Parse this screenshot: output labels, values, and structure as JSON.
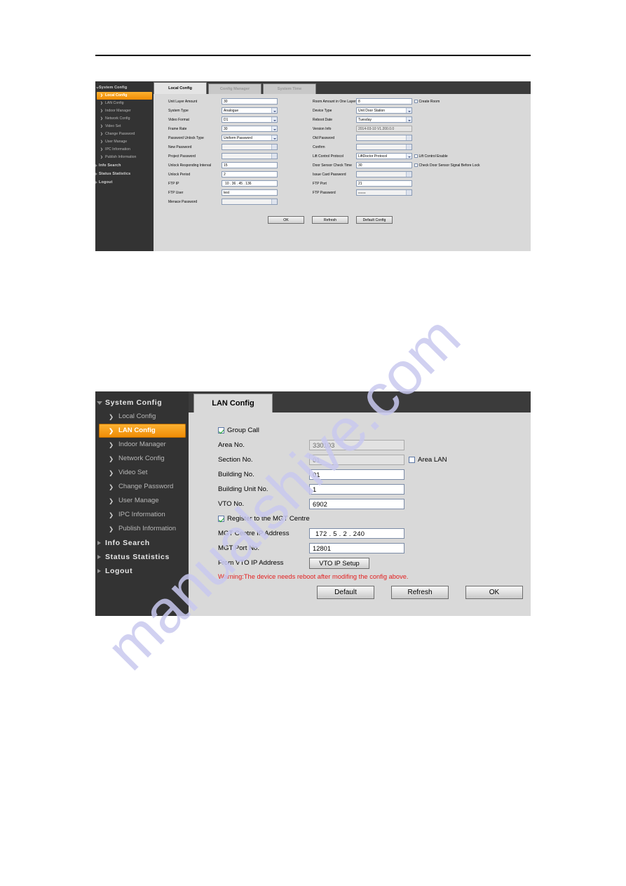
{
  "watermark": {
    "text": "manualshive.com"
  },
  "panel_local_config": {
    "tabs": [
      {
        "label": "Local Config",
        "active": true
      },
      {
        "label": "Config Manager",
        "active": false
      },
      {
        "label": "System Time",
        "active": false
      }
    ],
    "sidebar": {
      "groups": [
        {
          "label": "System Config",
          "expanded": true
        },
        {
          "label": "Info Search",
          "expanded": false
        },
        {
          "label": "Status Statistics",
          "expanded": false
        },
        {
          "label": "Logout",
          "expanded": false
        }
      ],
      "items": [
        {
          "label": "Local Config",
          "selected": true
        },
        {
          "label": "LAN Config",
          "selected": false
        },
        {
          "label": "Indoor Manager",
          "selected": false
        },
        {
          "label": "Network Config",
          "selected": false
        },
        {
          "label": "Video Set",
          "selected": false
        },
        {
          "label": "Change Password",
          "selected": false
        },
        {
          "label": "User Manage",
          "selected": false
        },
        {
          "label": "IPC Information",
          "selected": false
        },
        {
          "label": "Publish Information",
          "selected": false
        }
      ]
    },
    "left_fields": [
      {
        "label": "Unit Layer Amount",
        "value": "30",
        "type": "text"
      },
      {
        "label": "System Type",
        "value": "Analogue",
        "type": "select"
      },
      {
        "label": "Video Format",
        "value": "D1",
        "type": "select"
      },
      {
        "label": "Frame Rate",
        "value": "30",
        "type": "select"
      },
      {
        "label": "Password Unlock Type",
        "value": "Uniform Password",
        "type": "select"
      },
      {
        "label": "New Password",
        "value": "",
        "type": "password"
      },
      {
        "label": "Project Password",
        "value": "",
        "type": "password"
      },
      {
        "label": "Unlock Responding Interval",
        "value": "15",
        "type": "text"
      },
      {
        "label": "Unlock Period",
        "value": "2",
        "type": "text"
      },
      {
        "label": "FTP IP",
        "value": "10  .  36  .  45  .  136",
        "type": "ip"
      },
      {
        "label": "FTP User",
        "value": "test",
        "type": "text"
      },
      {
        "label": "Menace Password",
        "value": "",
        "type": "password"
      }
    ],
    "right_fields": [
      {
        "label": "Room Amount in One Layer",
        "value": "8",
        "type": "text",
        "checkbox": "Create Room",
        "checked": false
      },
      {
        "label": "Device Type",
        "value": "Unit Door Station",
        "type": "select"
      },
      {
        "label": "Reboot Date",
        "value": "Tuesday",
        "type": "select"
      },
      {
        "label": "Version Info",
        "value": "2014-03-10 V1.200.0.0",
        "type": "readonly"
      },
      {
        "label": "Old Password",
        "value": "",
        "type": "password"
      },
      {
        "label": "Confirm",
        "value": "",
        "type": "password"
      },
      {
        "label": "Lift Control Protocol",
        "value": "LiftDoctor Protocol",
        "type": "select",
        "checkbox": "Lift Control Enable",
        "checked": false
      },
      {
        "label": "Door Sensor Check Time",
        "value": "30",
        "type": "text",
        "checkbox": "Check Door Sensor Signal Before Lock",
        "checked": false
      },
      {
        "label": "Issue Card Password",
        "value": "",
        "type": "password"
      },
      {
        "label": "FTP Port",
        "value": "21",
        "type": "text"
      },
      {
        "label": "FTP Password",
        "value": "••••••",
        "type": "password"
      }
    ],
    "buttons": [
      {
        "label": "OK"
      },
      {
        "label": "Refresh"
      },
      {
        "label": "Default Config"
      }
    ]
  },
  "panel_lan_config": {
    "tab": {
      "label": "LAN Config"
    },
    "sidebar": {
      "groups": [
        {
          "label": "System Config",
          "expanded": true
        },
        {
          "label": "Info Search",
          "expanded": false
        },
        {
          "label": "Status Statistics",
          "expanded": false
        },
        {
          "label": "Logout",
          "expanded": false
        }
      ],
      "items": [
        {
          "label": "Local Config",
          "selected": false
        },
        {
          "label": "LAN Config",
          "selected": true
        },
        {
          "label": "Indoor Manager",
          "selected": false
        },
        {
          "label": "Network Config",
          "selected": false
        },
        {
          "label": "Video Set",
          "selected": false
        },
        {
          "label": "Change Password",
          "selected": false
        },
        {
          "label": "User Manage",
          "selected": false
        },
        {
          "label": "IPC Information",
          "selected": false
        },
        {
          "label": "Publish Information",
          "selected": false
        }
      ]
    },
    "group_call": {
      "label": "Group Call",
      "checked": true
    },
    "fields": [
      {
        "label": "Area No.",
        "value": "330103",
        "readonly": true
      },
      {
        "label": "Section No.",
        "value": "01",
        "readonly": true,
        "side_checkbox": "Area LAN",
        "side_checked": false
      },
      {
        "label": "Building No.",
        "value": "01",
        "readonly": false
      },
      {
        "label": "Building Unit No.",
        "value": "1",
        "readonly": false
      },
      {
        "label": "VTO No.",
        "value": "6902",
        "readonly": false
      }
    ],
    "register_mgt": {
      "label": "Register to the MGT Centre",
      "checked": true
    },
    "mgt_fields": [
      {
        "label": "MGT Centre IP Address",
        "value": "172  .  5  .  2  .  240"
      },
      {
        "label": "MGT Port No.",
        "value": "12801"
      }
    ],
    "vto_ip": {
      "label": "From VTO IP Address",
      "button": "VTO IP Setup"
    },
    "warning": "Warning:The device needs reboot after modifing the config above.",
    "buttons": [
      {
        "label": "Default"
      },
      {
        "label": "Refresh"
      },
      {
        "label": "OK"
      }
    ]
  }
}
